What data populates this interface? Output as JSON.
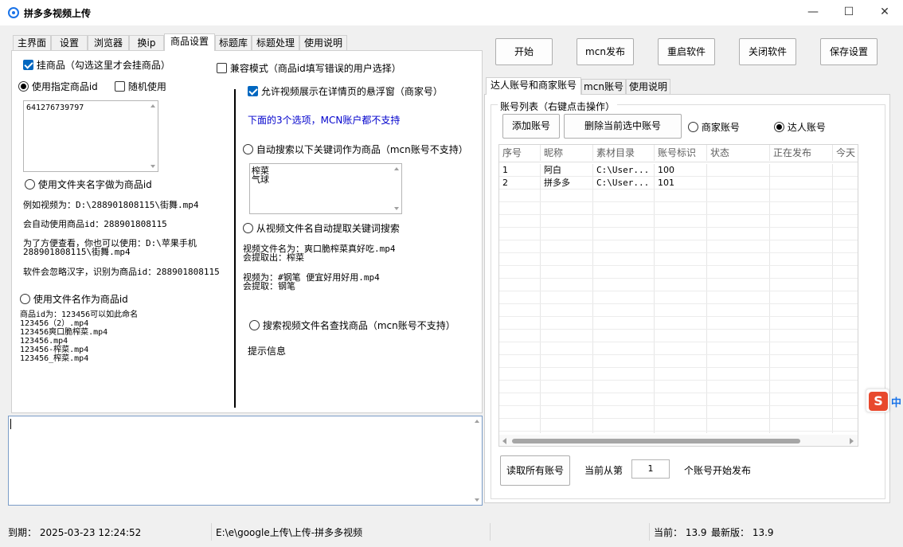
{
  "window": {
    "title": "拼多多视频上传",
    "minimize": "—",
    "maximize": "☐",
    "close": "✕"
  },
  "left_tabs": [
    "主界面",
    "设置",
    "浏览器",
    "换ip",
    "商品设置",
    "标题库",
    "标题处理",
    "使用说明"
  ],
  "product": {
    "mount_label": "挂商品（勾选这里才会挂商品）",
    "compat_label": "兼容模式（商品id填写错误的用户选择）",
    "use_specified_label": "使用指定商品id",
    "random_label": "随机使用",
    "specified_ids": "641276739797",
    "folder_name_label": "使用文件夹名字做为商品id",
    "folder_example_1": "例如视频为：D:\\288901808115\\街舞.mp4",
    "folder_example_2": "会自动使用商品id：288901808115",
    "folder_example_3": "为了方便查看，你也可以使用：D:\\苹果手机\n288901808115\\街舞.mp4",
    "folder_example_4": "软件会忽略汉字，识别为商品id：288901808115",
    "file_name_label": "使用文件名作为商品id",
    "file_name_examples": "商品id为：123456可以如此命名\n123456（2）.mp4\n123456爽口脆榨菜.mp4\n123456.mp4\n123456-榨菜.mp4\n123456_榨菜.mp4",
    "allow_float_label": "允许视频展示在详情页的悬浮窗（商家号）",
    "mcn_note": "下面的3个选项，MCN账户都不支持",
    "auto_search_label": "自动搜索以下关键词作为商品（mcn账号不支持）",
    "keywords": "榨菜\n气球",
    "extract_label": "从视频文件名自动提取关键词搜索",
    "extract_example_1": "视频文件名为：爽口脆榨菜真好吃.mp4\n会提取出：榨菜",
    "extract_example_2": "视频为：#钢笔 便宜好用好用.mp4\n会提取：钢笔",
    "search_filename_label": "搜索视频文件名查找商品（mcn账号不支持）",
    "hint_label": "提示信息"
  },
  "log": {
    "value": ""
  },
  "toolbar": {
    "start": "开始",
    "mcn_publish": "mcn发布",
    "restart": "重启软件",
    "close_app": "关闭软件",
    "save_settings": "保存设置"
  },
  "right_tabs": [
    "达人账号和商家账号",
    "mcn账号",
    "使用说明"
  ],
  "accounts": {
    "group_label": "账号列表（右键点击操作）",
    "add_button": "添加账号",
    "delete_button": "删除当前选中账号",
    "merchant_label": "商家账号",
    "influencer_label": "达人账号",
    "columns": [
      "序号",
      "昵称",
      "素材目录",
      "账号标识",
      "状态",
      "正在发布",
      "今天"
    ],
    "rows": [
      [
        "1",
        "阿白",
        "C:\\User...",
        "100",
        "",
        "",
        ""
      ],
      [
        "2",
        "拼多多",
        "C:\\User...",
        "101",
        "",
        "",
        ""
      ]
    ],
    "read_all_button": "读取所有账号",
    "start_from_label": "当前从第",
    "start_from_value": "1",
    "start_from_suffix": "个账号开始发布"
  },
  "status": {
    "expiry": "到期：  2025-03-23 12:24:52",
    "path": "E:\\e\\google上传\\上传-拼多多视频",
    "current": "当前：  13.9",
    "latest": "最新版：  13.9"
  },
  "ime": {
    "icon": "S",
    "text": "中"
  },
  "colors": {
    "accent": "#0067c0",
    "note_blue": "#0000cc",
    "sougou_red": "#e8492d"
  }
}
